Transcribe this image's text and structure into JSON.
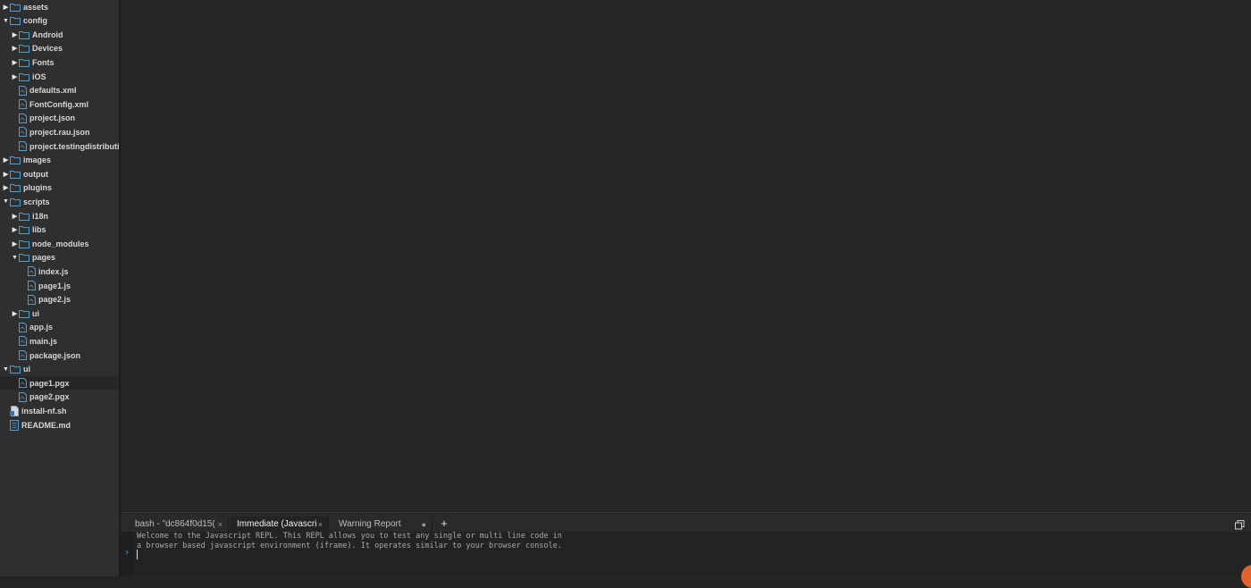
{
  "file_tree": {
    "items": [
      {
        "label": "assets",
        "type": "folder",
        "expanded": false
      },
      {
        "label": "config",
        "type": "folder",
        "expanded": true
      },
      {
        "label": "Android",
        "type": "folder",
        "expanded": false
      },
      {
        "label": "Devices",
        "type": "folder",
        "expanded": false
      },
      {
        "label": "Fonts",
        "type": "folder",
        "expanded": false
      },
      {
        "label": "iOS",
        "type": "folder",
        "expanded": false
      },
      {
        "label": "defaults.xml",
        "type": "file"
      },
      {
        "label": "FontConfig.xml",
        "type": "file"
      },
      {
        "label": "project.json",
        "type": "file"
      },
      {
        "label": "project.rau.json",
        "type": "file"
      },
      {
        "label": "project.testingdistribution.json",
        "type": "file"
      },
      {
        "label": "images",
        "type": "folder",
        "expanded": false
      },
      {
        "label": "output",
        "type": "folder",
        "expanded": false
      },
      {
        "label": "plugins",
        "type": "folder",
        "expanded": false
      },
      {
        "label": "scripts",
        "type": "folder",
        "expanded": true
      },
      {
        "label": "i18n",
        "type": "folder",
        "expanded": false
      },
      {
        "label": "libs",
        "type": "folder",
        "expanded": false
      },
      {
        "label": "node_modules",
        "type": "folder",
        "expanded": false
      },
      {
        "label": "pages",
        "type": "folder",
        "expanded": true
      },
      {
        "label": "index.js",
        "type": "file"
      },
      {
        "label": "page1.js",
        "type": "file"
      },
      {
        "label": "page2.js",
        "type": "file"
      },
      {
        "label": "ui",
        "type": "folder",
        "expanded": false
      },
      {
        "label": "app.js",
        "type": "file"
      },
      {
        "label": "main.js",
        "type": "file"
      },
      {
        "label": "package.json",
        "type": "file"
      },
      {
        "label": "ui",
        "type": "folder",
        "expanded": true
      },
      {
        "label": "page1.pgx",
        "type": "file",
        "selected": true
      },
      {
        "label": "page2.pgx",
        "type": "file"
      },
      {
        "label": "install-nf.sh",
        "type": "script-file"
      },
      {
        "label": "README.md",
        "type": "doc-file"
      }
    ]
  },
  "panel": {
    "tabs": [
      {
        "label": "bash - \"dc864f0d15(",
        "close": "×",
        "active": false
      },
      {
        "label": "Immediate (Javascri",
        "close": "×",
        "active": true
      },
      {
        "label": "Warning Report",
        "close": "●",
        "active": false
      }
    ],
    "new_tab_label": "+",
    "console": {
      "line1": "Welcome to the Javascript REPL. This REPL allows you to test any single or multi line code in",
      "line2": "a browser based javascript environment (iframe). It operates similar to your browser console.",
      "prompt": "›"
    }
  },
  "icons": {
    "expand": "triangle-right-icon",
    "collapse": "triangle-down-icon",
    "folder": "folder-icon",
    "file": "file-icon",
    "maximize": "maximize-icon"
  },
  "colors": {
    "icon_blue": "#4d9fd8",
    "prompt_blue": "#4da0e0",
    "accent_orange": "#e2622c"
  }
}
